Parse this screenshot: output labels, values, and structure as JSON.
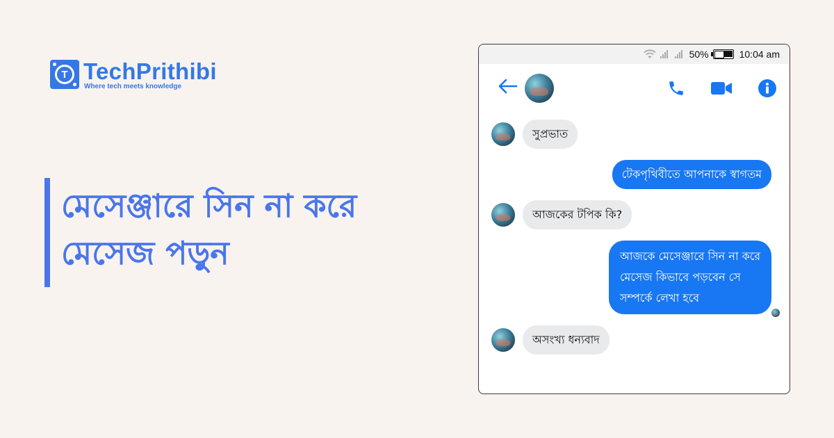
{
  "brand": {
    "name": "TechPrithibi",
    "tagline": "Where tech meets knowledge",
    "logo_letter": "T",
    "color": "#3578e5"
  },
  "headline": {
    "line1": "মেসেঞ্জারে সিন না করে",
    "line2": "মেসেজ পড়ুন",
    "color": "#4a76ea"
  },
  "phone": {
    "status_bar": {
      "battery": "50%",
      "time": "10:04 am",
      "icons": [
        "wifi-icon",
        "signal-icon",
        "signal-icon",
        "battery-icon"
      ]
    },
    "header": {
      "icons": [
        "back-arrow-icon",
        "phone-icon",
        "video-camera-icon",
        "info-icon"
      ],
      "accent": "#1877f2"
    },
    "messages": [
      {
        "direction": "incoming",
        "text": "সুপ্রভাত"
      },
      {
        "direction": "outgoing",
        "text": "টেকপৃথিবীতে আপনাকে স্বাগতম"
      },
      {
        "direction": "incoming",
        "text": "আজকের টপিক কি?"
      },
      {
        "direction": "outgoing",
        "lines": [
          "আজকে মেসেঞ্জারে সিন না করে",
          "মেসেজ কিভাবে পড়বেন সে",
          "সম্পর্কে লেখা হবে"
        ]
      },
      {
        "direction": "incoming",
        "text": "অসংখ্য ধন্যবাদ"
      }
    ]
  }
}
